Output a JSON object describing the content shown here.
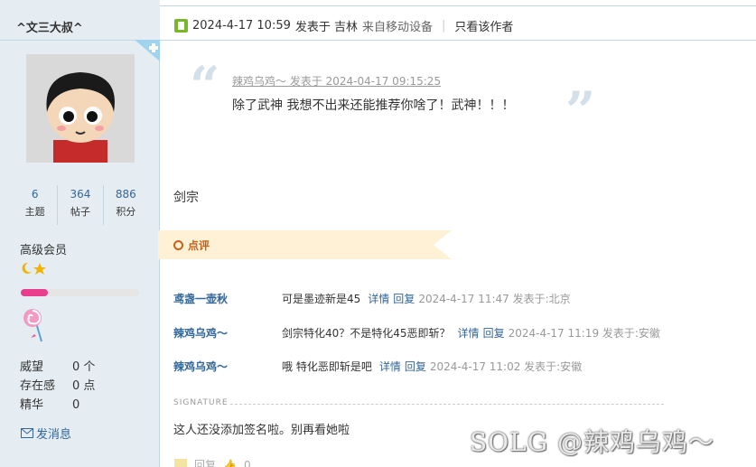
{
  "user": {
    "name": "^文三大叔^",
    "stats": [
      {
        "value": "6",
        "label": "主题"
      },
      {
        "value": "364",
        "label": "帖子"
      },
      {
        "value": "886",
        "label": "积分"
      }
    ],
    "rank": "高级会员",
    "level_progress": 0.23,
    "profile": [
      {
        "label": "威望",
        "value": "0 个"
      },
      {
        "label": "存在感",
        "value": "0 点"
      },
      {
        "label": "精华",
        "value": "0"
      }
    ],
    "send_message": "发消息"
  },
  "post": {
    "date": "2024-4-17 10:59",
    "posted_in": "发表于 吉林",
    "device": "来自移动设备",
    "only_author": "只看该作者",
    "quote": {
      "author_line": "辣鸡乌鸡～ 发表于 2024-04-17 09:15:25",
      "text": "除了武神  我想不出来还能推荐你啥了！武神！！！"
    },
    "body": "剑宗"
  },
  "review": {
    "label": "点评",
    "comments": [
      {
        "user": "鸢盏一壶秋",
        "text": "可是墨迹新是45",
        "detail": "详情",
        "reply": "回复",
        "time": "2024-4-17 11:47 发表于:北京"
      },
      {
        "user": "辣鸡乌鸡～",
        "text": "剑宗特化40？不是特化45恶即斩？",
        "detail": "详情",
        "reply": "回复",
        "time": "2024-4-17 11:19 发表于:安徽"
      },
      {
        "user": "辣鸡乌鸡～",
        "text": "哦 特化恶即斩是吧",
        "detail": "详情",
        "reply": "回复",
        "time": "2024-4-17 11:02 发表于:安徽"
      }
    ]
  },
  "signature": {
    "label": "SIGNATURE",
    "text": "这人还没添加签名啦。别再看她啦"
  },
  "bottom": {
    "reply_label": "回复",
    "like_count": "0"
  },
  "watermark": "SOLG @辣鸡乌鸡～",
  "colors": {
    "sidebar_bg": "#e5edf2",
    "link": "#336699",
    "review_accent": "#c3621b",
    "review_banner": "#fff1d6"
  },
  "icons": {
    "meta": "post-status-icon",
    "review": "circle-icon",
    "mail": "mail-icon"
  }
}
